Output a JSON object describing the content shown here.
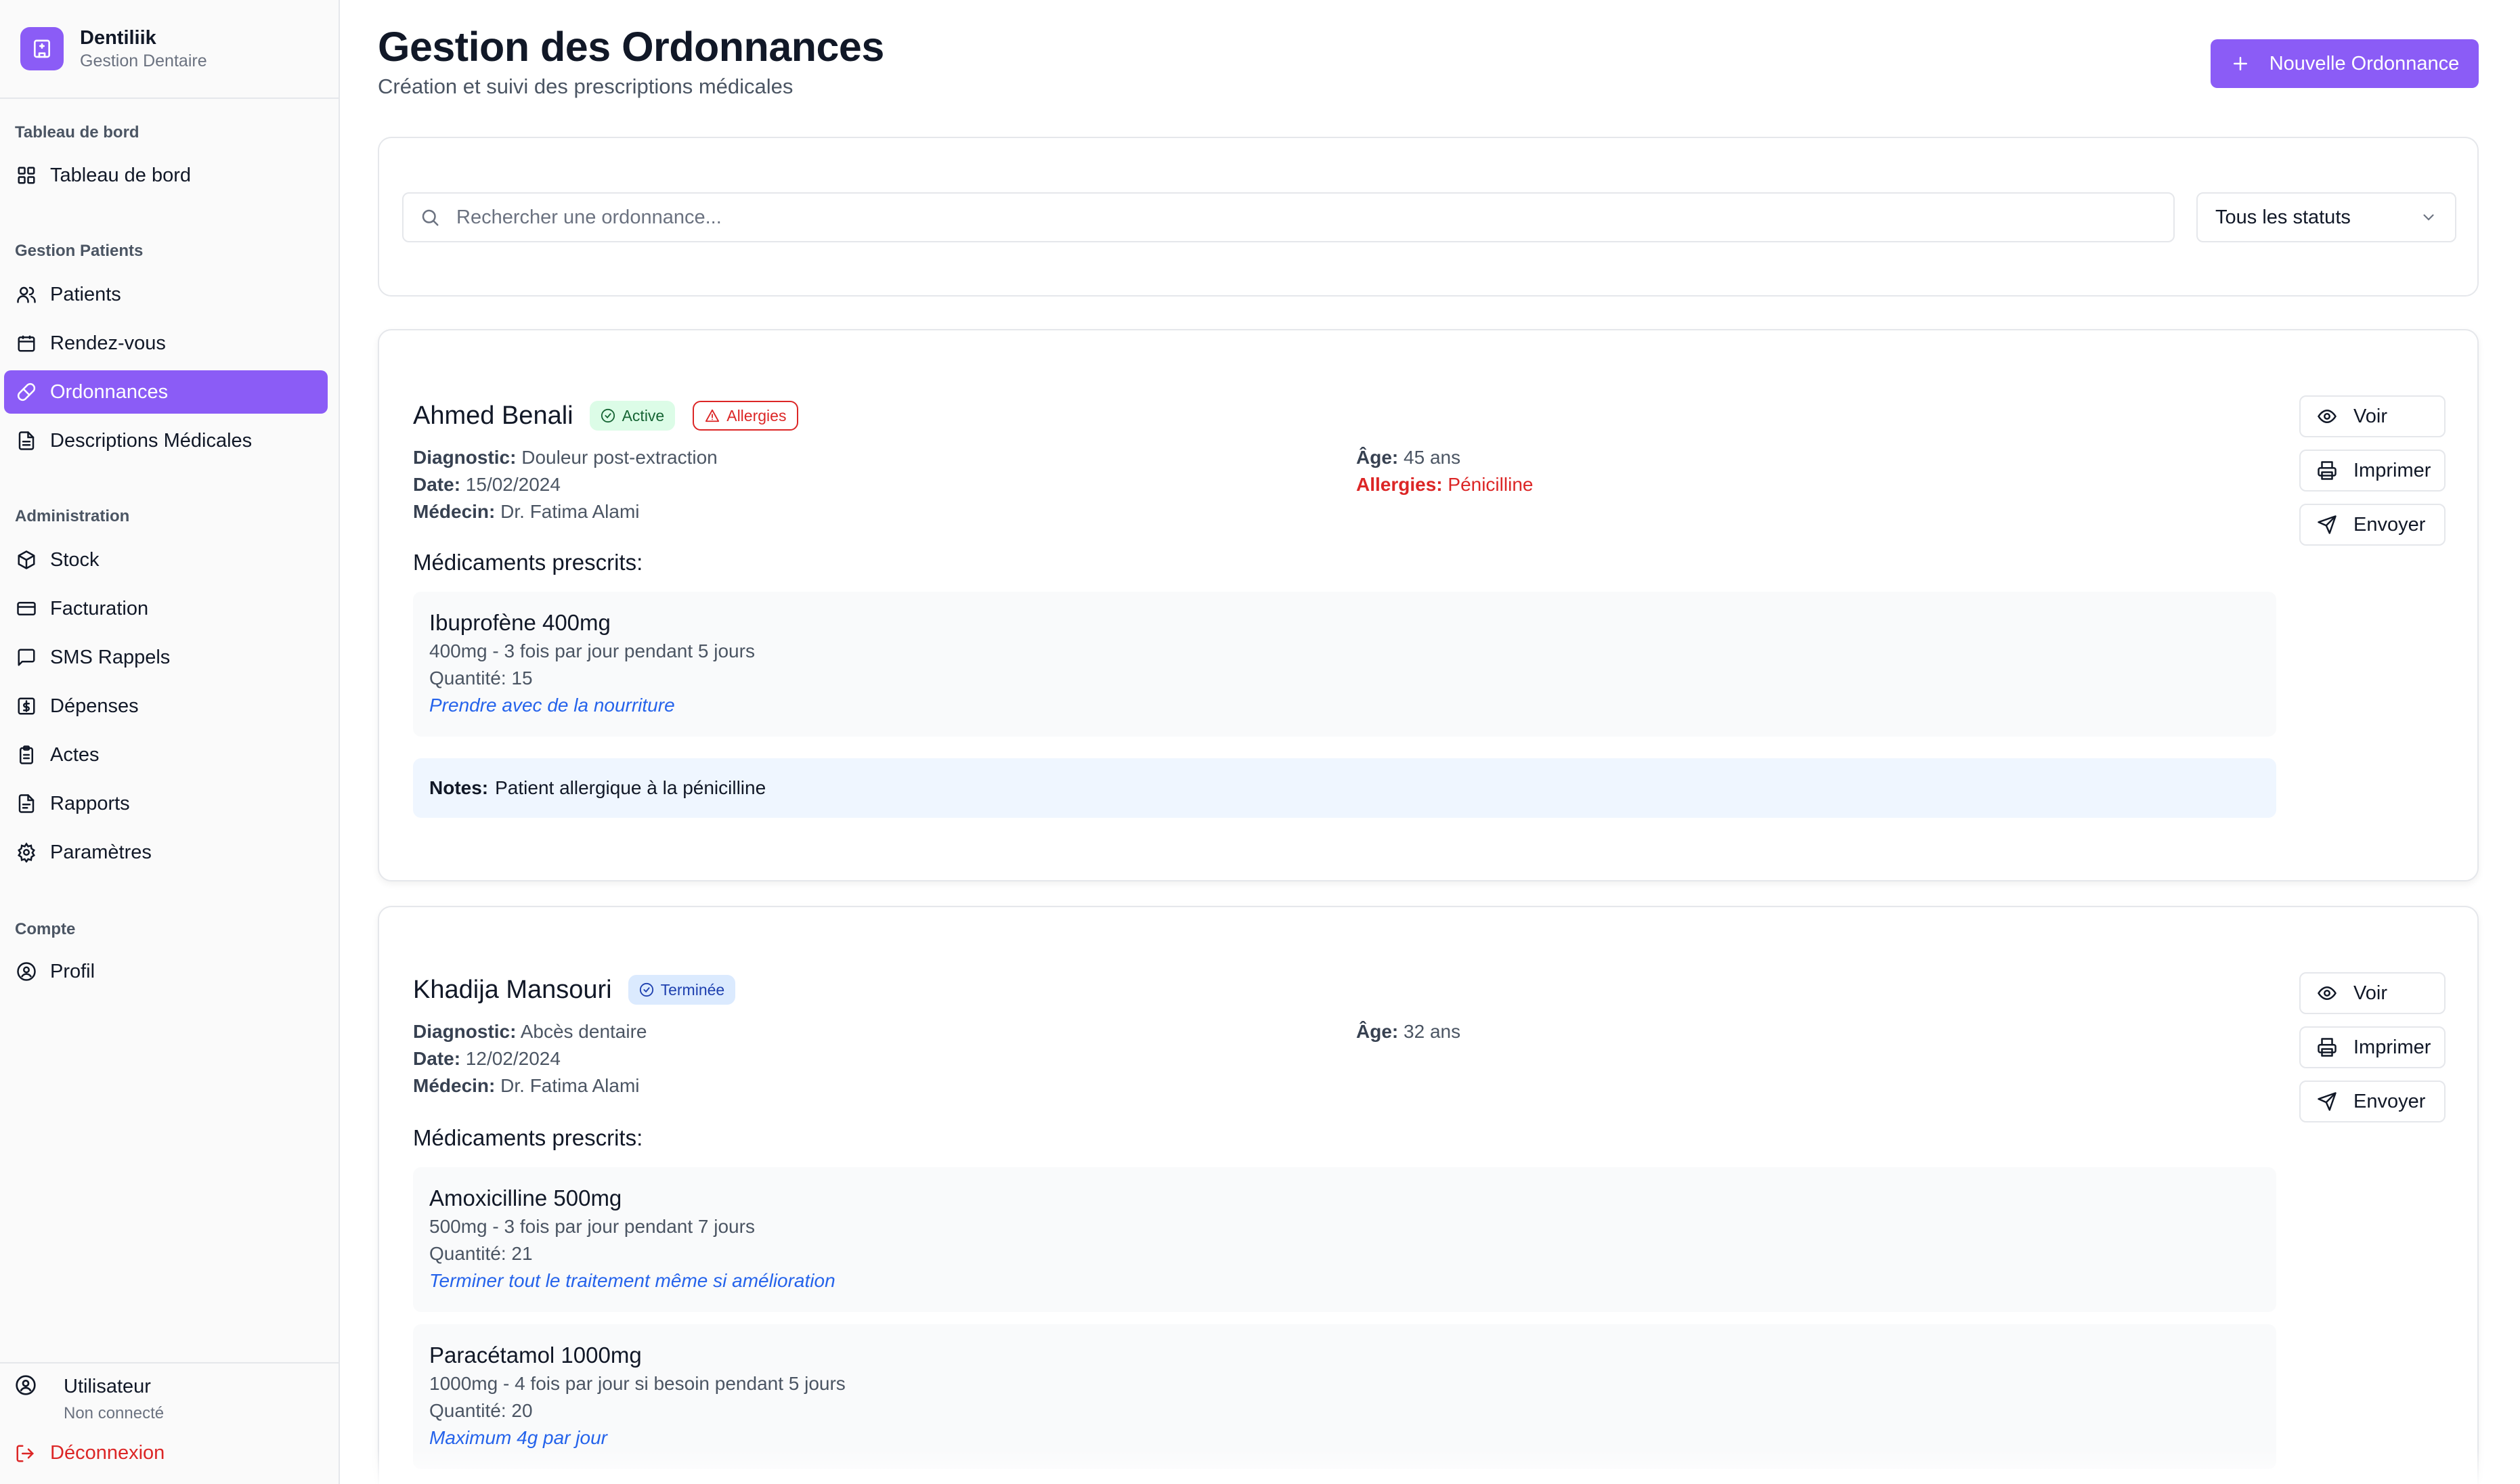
{
  "brand": {
    "name": "Dentiliik",
    "subtitle": "Gestion Dentaire",
    "logo_icon": "hospital-icon"
  },
  "sidebar": {
    "groups": [
      {
        "title": "Tableau de bord",
        "items": [
          {
            "label": "Tableau de bord",
            "icon": "grid-icon"
          }
        ]
      },
      {
        "title": "Gestion Patients",
        "items": [
          {
            "label": "Patients",
            "icon": "users-icon"
          },
          {
            "label": "Rendez-vous",
            "icon": "calendar-icon"
          },
          {
            "label": "Ordonnances",
            "icon": "pill-icon",
            "active": true
          },
          {
            "label": "Descriptions Médicales",
            "icon": "file-text-icon"
          }
        ]
      },
      {
        "title": "Administration",
        "items": [
          {
            "label": "Stock",
            "icon": "package-icon"
          },
          {
            "label": "Facturation",
            "icon": "credit-card-icon"
          },
          {
            "label": "SMS Rappels",
            "icon": "message-icon"
          },
          {
            "label": "Dépenses",
            "icon": "dollar-icon"
          },
          {
            "label": "Actes",
            "icon": "clipboard-icon"
          },
          {
            "label": "Rapports",
            "icon": "report-icon"
          },
          {
            "label": "Paramètres",
            "icon": "gear-icon"
          }
        ]
      },
      {
        "title": "Compte",
        "items": [
          {
            "label": "Profil",
            "icon": "user-circle-icon"
          }
        ]
      }
    ],
    "user": {
      "name": "Utilisateur",
      "status": "Non connecté"
    },
    "logout_label": "Déconnexion"
  },
  "header": {
    "title": "Gestion des Ordonnances",
    "subtitle": "Création et suivi des prescriptions médicales",
    "new_button": "Nouvelle Ordonnance"
  },
  "filters": {
    "search_placeholder": "Rechercher une ordonnance...",
    "status_value": "Tous les statuts"
  },
  "labels": {
    "diagnostic": "Diagnostic:",
    "date": "Date:",
    "medecin": "Médecin:",
    "age": "Âge:",
    "allergies": "Allergies:",
    "meds_title": "Médicaments prescrits:",
    "notes": "Notes:",
    "view": "Voir",
    "print": "Imprimer",
    "send": "Envoyer"
  },
  "prescriptions": [
    {
      "patient": "Ahmed Benali",
      "status": "Active",
      "allergy_badge": "Allergies",
      "diagnostic": "Douleur post-extraction",
      "date": "15/02/2024",
      "medecin": "Dr. Fatima Alami",
      "age": "45 ans",
      "allergies": "Pénicilline",
      "medications": [
        {
          "name": "Ibuprofène 400mg",
          "dosage": "400mg - 3 fois par jour pendant 5 jours",
          "quantity": "Quantité: 15",
          "instruction": "Prendre avec de la nourriture"
        }
      ],
      "notes": "Patient allergique à la pénicilline"
    },
    {
      "patient": "Khadija Mansouri",
      "status": "Terminée",
      "diagnostic": "Abcès dentaire",
      "date": "12/02/2024",
      "medecin": "Dr. Fatima Alami",
      "age": "32 ans",
      "medications": [
        {
          "name": "Amoxicilline 500mg",
          "dosage": "500mg - 3 fois par jour pendant 7 jours",
          "quantity": "Quantité: 21",
          "instruction": "Terminer tout le traitement même si amélioration"
        },
        {
          "name": "Paracétamol 1000mg",
          "dosage": "1000mg - 4 fois par jour si besoin pendant 5 jours",
          "quantity": "Quantité: 20",
          "instruction": "Maximum 4g par jour"
        }
      ]
    }
  ],
  "colors": {
    "accent": "#8b5cf6",
    "danger": "#dc2626",
    "link": "#2563eb",
    "active_badge_bg": "#dcfce7",
    "done_badge_bg": "#dbeafe"
  }
}
